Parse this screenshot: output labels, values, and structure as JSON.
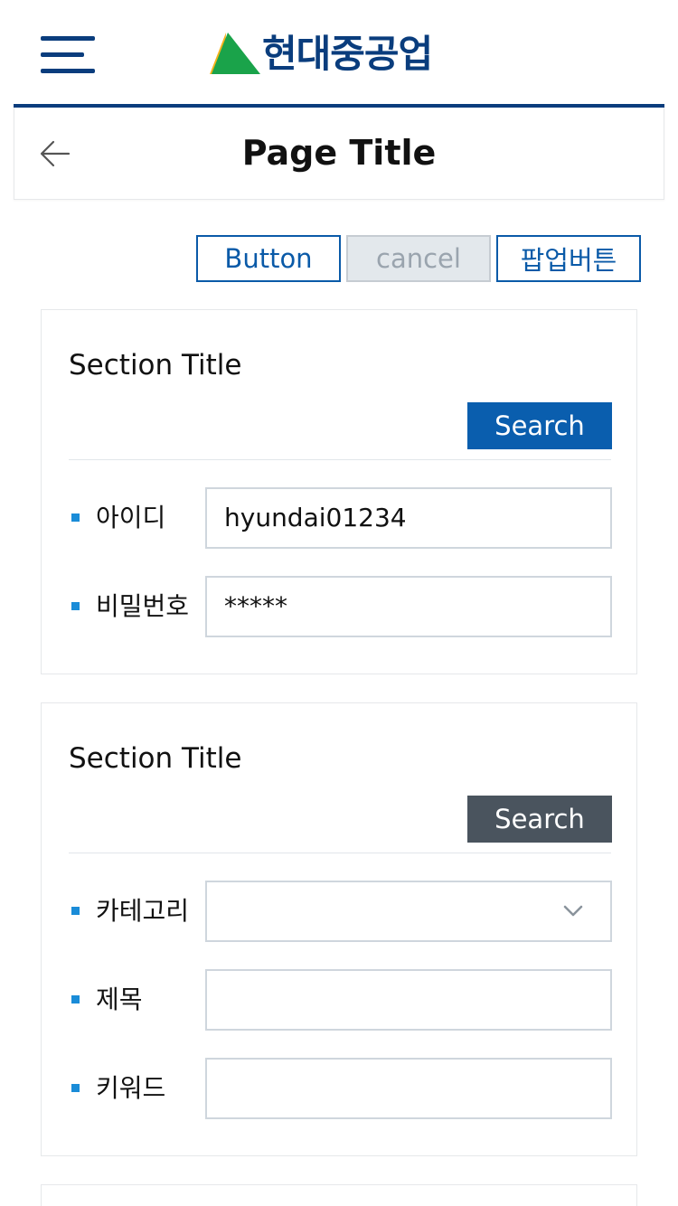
{
  "header": {
    "logo_text": "현대중공업",
    "logo_colors": {
      "text": "#0a3d7d",
      "green": "#1aa34a",
      "yellow": "#f5b21b"
    }
  },
  "title_bar": {
    "title": "Page Title"
  },
  "top_buttons": {
    "button_label": "Button",
    "cancel_label": "cancel",
    "popup_label": "팝업버튼"
  },
  "section1": {
    "title": "Section Title",
    "search_label": "Search",
    "fields": [
      {
        "label": "아이디",
        "value": "hyundai01234"
      },
      {
        "label": "비밀번호",
        "value": "*****"
      }
    ]
  },
  "section2": {
    "title": "Section Title",
    "search_label": "Search",
    "fields": [
      {
        "label": "카테고리",
        "value": ""
      },
      {
        "label": "제목",
        "value": ""
      },
      {
        "label": "키워드",
        "value": ""
      }
    ]
  },
  "colors": {
    "primary": "#0a5eae",
    "navy": "#0a3d7d",
    "dark_button": "#4a545e",
    "bullet": "#1a8cd8"
  }
}
